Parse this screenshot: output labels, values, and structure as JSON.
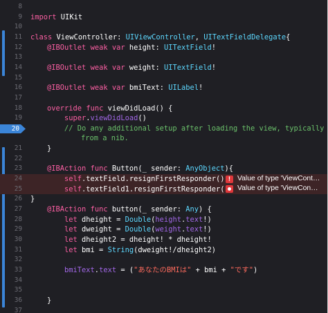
{
  "editor": {
    "lines": [
      {
        "num": "8",
        "tokens": []
      },
      {
        "num": "9",
        "tokens": [
          {
            "t": "import",
            "c": "kw"
          },
          {
            "t": " UIKit",
            "c": "ident"
          }
        ]
      },
      {
        "num": "10",
        "tokens": []
      },
      {
        "num": "11",
        "tokens": [
          {
            "t": "class",
            "c": "kw"
          },
          {
            "t": " ViewController: ",
            "c": "ident"
          },
          {
            "t": "UIViewController",
            "c": "cl"
          },
          {
            "t": ", ",
            "c": "ident"
          },
          {
            "t": "UITextFieldDelegate",
            "c": "cl"
          },
          {
            "t": "{",
            "c": "ident"
          }
        ]
      },
      {
        "num": "12",
        "tokens": [
          {
            "t": "@IBOutlet",
            "c": "kw"
          },
          {
            "t": " ",
            "c": "ident"
          },
          {
            "t": "weak",
            "c": "kw"
          },
          {
            "t": " ",
            "c": "ident"
          },
          {
            "t": "var",
            "c": "kw"
          },
          {
            "t": " height: ",
            "c": "ident"
          },
          {
            "t": "UITextField",
            "c": "cl"
          },
          {
            "t": "!",
            "c": "ident"
          }
        ]
      },
      {
        "num": "13",
        "tokens": []
      },
      {
        "num": "14",
        "tokens": [
          {
            "t": "@IBOutlet",
            "c": "kw"
          },
          {
            "t": " ",
            "c": "ident"
          },
          {
            "t": "weak",
            "c": "kw"
          },
          {
            "t": " ",
            "c": "ident"
          },
          {
            "t": "var",
            "c": "kw"
          },
          {
            "t": " weight: ",
            "c": "ident"
          },
          {
            "t": "UITextField",
            "c": "cl"
          },
          {
            "t": "!",
            "c": "ident"
          }
        ]
      },
      {
        "num": "15",
        "tokens": []
      },
      {
        "num": "16",
        "tokens": [
          {
            "t": "@IBOutlet",
            "c": "kw"
          },
          {
            "t": " ",
            "c": "ident"
          },
          {
            "t": "weak",
            "c": "kw"
          },
          {
            "t": " ",
            "c": "ident"
          },
          {
            "t": "var",
            "c": "kw"
          },
          {
            "t": " bmiText: ",
            "c": "ident"
          },
          {
            "t": "UILabel",
            "c": "cl"
          },
          {
            "t": "!",
            "c": "ident"
          }
        ]
      },
      {
        "num": "17",
        "tokens": []
      },
      {
        "num": "18",
        "tokens": [
          {
            "t": "override",
            "c": "kw"
          },
          {
            "t": " ",
            "c": "ident"
          },
          {
            "t": "func",
            "c": "kw"
          },
          {
            "t": " viewDidLoad() {",
            "c": "ident"
          }
        ]
      },
      {
        "num": "19",
        "tokens": [
          {
            "t": "super",
            "c": "kw"
          },
          {
            "t": ".",
            "c": "ident"
          },
          {
            "t": "viewDidLoad",
            "c": "pr"
          },
          {
            "t": "()",
            "c": "ident"
          }
        ]
      },
      {
        "num": "20",
        "tokens": [
          {
            "t": "// Do any additional setup after loading the view, typically",
            "c": "cm"
          }
        ]
      },
      {
        "num": "",
        "tokens": [
          {
            "t": "from a nib.",
            "c": "cm"
          }
        ]
      },
      {
        "num": "21",
        "tokens": [
          {
            "t": "}",
            "c": "ident"
          }
        ]
      },
      {
        "num": "22",
        "tokens": []
      },
      {
        "num": "23",
        "tokens": [
          {
            "t": "@IBAction",
            "c": "kw"
          },
          {
            "t": " ",
            "c": "ident"
          },
          {
            "t": "func",
            "c": "kw"
          },
          {
            "t": " Button(_ sender: ",
            "c": "ident"
          },
          {
            "t": "AnyObject",
            "c": "cl"
          },
          {
            "t": "){",
            "c": "ident"
          }
        ]
      },
      {
        "num": "24",
        "tokens": [
          {
            "t": "self",
            "c": "kw"
          },
          {
            "t": ".textField.resignFirstResponder()",
            "c": "ident"
          }
        ]
      },
      {
        "num": "25",
        "tokens": [
          {
            "t": "self",
            "c": "kw"
          },
          {
            "t": ".textField1.resignFirstResponder()",
            "c": "ident"
          }
        ]
      },
      {
        "num": "26",
        "tokens": [
          {
            "t": "}",
            "c": "ident"
          }
        ]
      },
      {
        "num": "27",
        "tokens": [
          {
            "t": "@IBAction",
            "c": "kw"
          },
          {
            "t": " ",
            "c": "ident"
          },
          {
            "t": "func",
            "c": "kw"
          },
          {
            "t": " button(_ sender: ",
            "c": "ident"
          },
          {
            "t": "Any",
            "c": "cl"
          },
          {
            "t": ") {",
            "c": "ident"
          }
        ]
      },
      {
        "num": "28",
        "tokens": [
          {
            "t": "let",
            "c": "kw"
          },
          {
            "t": " dheight = ",
            "c": "ident"
          },
          {
            "t": "Double",
            "c": "cl"
          },
          {
            "t": "(",
            "c": "ident"
          },
          {
            "t": "height",
            "c": "pr"
          },
          {
            "t": ".",
            "c": "ident"
          },
          {
            "t": "text",
            "c": "pr"
          },
          {
            "t": "!)",
            "c": "ident"
          }
        ]
      },
      {
        "num": "29",
        "tokens": [
          {
            "t": "let",
            "c": "kw"
          },
          {
            "t": " dweight = ",
            "c": "ident"
          },
          {
            "t": "Double",
            "c": "cl"
          },
          {
            "t": "(",
            "c": "ident"
          },
          {
            "t": "weight",
            "c": "pr"
          },
          {
            "t": ".",
            "c": "ident"
          },
          {
            "t": "text",
            "c": "pr"
          },
          {
            "t": "!)",
            "c": "ident"
          }
        ]
      },
      {
        "num": "30",
        "tokens": [
          {
            "t": "let",
            "c": "kw"
          },
          {
            "t": " dheight2 = dheight! * dheight!",
            "c": "ident"
          }
        ]
      },
      {
        "num": "31",
        "tokens": [
          {
            "t": "let",
            "c": "kw"
          },
          {
            "t": " bmi = ",
            "c": "ident"
          },
          {
            "t": "String",
            "c": "cl"
          },
          {
            "t": "(dweight!/dheight2)",
            "c": "ident"
          }
        ]
      },
      {
        "num": "32",
        "tokens": []
      },
      {
        "num": "33",
        "tokens": [
          {
            "t": "bmiText",
            "c": "pr"
          },
          {
            "t": ".",
            "c": "ident"
          },
          {
            "t": "text",
            "c": "pr"
          },
          {
            "t": " = (",
            "c": "ident"
          },
          {
            "t": "\"あなたのBMIは\"",
            "c": "st"
          },
          {
            "t": " + bmi + ",
            "c": "ident"
          },
          {
            "t": "\"です\"",
            "c": "st"
          },
          {
            "t": ")",
            "c": "ident"
          }
        ]
      },
      {
        "num": "34",
        "tokens": []
      },
      {
        "num": "35",
        "tokens": []
      },
      {
        "num": "36",
        "tokens": [
          {
            "t": "}",
            "c": "ident"
          }
        ]
      },
      {
        "num": "37",
        "tokens": []
      }
    ],
    "errors": [
      {
        "line": "24",
        "icon": "error-exclamation-icon",
        "text": "Value of type 'ViewCont…"
      },
      {
        "line": "25",
        "icon": "error-dot-icon",
        "text": "Value of type 'ViewCon…"
      }
    ],
    "current_line": "20",
    "colors": {
      "background": "#1f1f24",
      "keyword": "#fc5fa3",
      "class_type": "#5dd8ff",
      "property": "#a167e6",
      "comment": "#6bc26b",
      "string": "#fc6a5d",
      "error_line_bg": "#3d2426",
      "error_icon": "#e0383b",
      "breakpoint": "#3b85d8"
    }
  }
}
